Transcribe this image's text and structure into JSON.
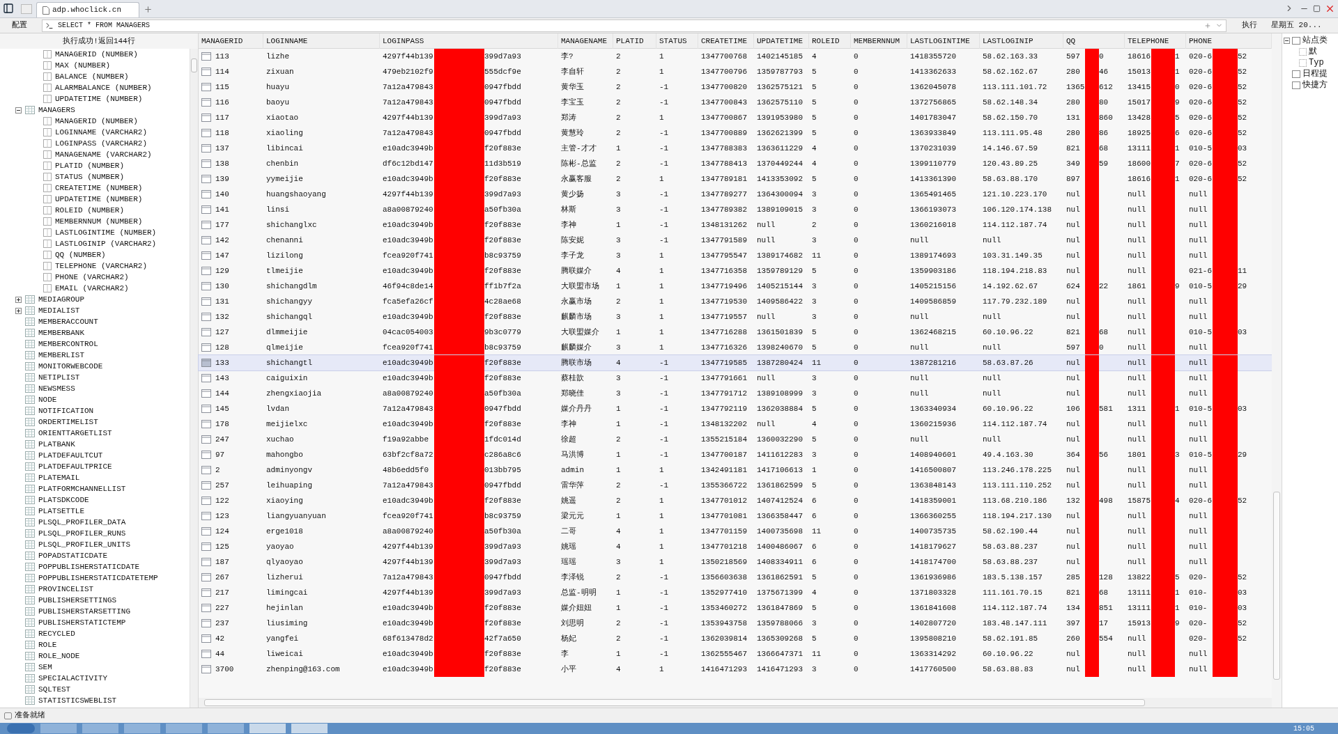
{
  "browser": {
    "tab_title": "adp.whoclick.cn",
    "date_text": "星期五 20...",
    "clock": "15:05"
  },
  "toolbar": {
    "config_button": "配置",
    "sql": "SELECT * FROM MANAGERS",
    "run_button": "执行"
  },
  "result_message": "执行成功!返回144行",
  "tree": [
    {
      "label": "MANAGERID (NUMBER)",
      "kind": "column"
    },
    {
      "label": "MAX (NUMBER)",
      "kind": "column"
    },
    {
      "label": "BALANCE (NUMBER)",
      "kind": "column"
    },
    {
      "label": "ALARMBALANCE (NUMBER)",
      "kind": "column"
    },
    {
      "label": "UPDATETIME (NUMBER)",
      "kind": "column"
    },
    {
      "label": "MANAGERS",
      "kind": "table",
      "expanded": true,
      "children": [
        {
          "label": "MANAGERID (NUMBER)",
          "kind": "column"
        },
        {
          "label": "LOGINNAME (VARCHAR2)",
          "kind": "column"
        },
        {
          "label": "LOGINPASS (VARCHAR2)",
          "kind": "column"
        },
        {
          "label": "MANAGENAME (VARCHAR2)",
          "kind": "column"
        },
        {
          "label": "PLATID (NUMBER)",
          "kind": "column"
        },
        {
          "label": "STATUS (NUMBER)",
          "kind": "column"
        },
        {
          "label": "CREATETIME (NUMBER)",
          "kind": "column"
        },
        {
          "label": "UPDATETIME (NUMBER)",
          "kind": "column"
        },
        {
          "label": "ROLEID (NUMBER)",
          "kind": "column"
        },
        {
          "label": "MEMBERNNUM (NUMBER)",
          "kind": "column"
        },
        {
          "label": "LASTLOGINTIME (NUMBER)",
          "kind": "column"
        },
        {
          "label": "LASTLOGINIP (VARCHAR2)",
          "kind": "column"
        },
        {
          "label": "QQ (NUMBER)",
          "kind": "column"
        },
        {
          "label": "TELEPHONE (VARCHAR2)",
          "kind": "column"
        },
        {
          "label": "PHONE (VARCHAR2)",
          "kind": "column"
        },
        {
          "label": "EMAIL (VARCHAR2)",
          "kind": "column"
        }
      ]
    },
    {
      "label": "MEDIAGROUP",
      "kind": "table",
      "expanded": false
    },
    {
      "label": "MEDIALIST",
      "kind": "table",
      "expanded": false
    },
    {
      "label": "MEMBERACCOUNT",
      "kind": "table"
    },
    {
      "label": "MEMBERBANK",
      "kind": "table"
    },
    {
      "label": "MEMBERCONTROL",
      "kind": "table"
    },
    {
      "label": "MEMBERLIST",
      "kind": "table"
    },
    {
      "label": "MONITORWEBCODE",
      "kind": "table"
    },
    {
      "label": "NETIPLIST",
      "kind": "table"
    },
    {
      "label": "NEWSMESS",
      "kind": "table"
    },
    {
      "label": "NODE",
      "kind": "table"
    },
    {
      "label": "NOTIFICATION",
      "kind": "table"
    },
    {
      "label": "ORDERTIMELIST",
      "kind": "table"
    },
    {
      "label": "ORIENTTARGETLIST",
      "kind": "table"
    },
    {
      "label": "PLATBANK",
      "kind": "table"
    },
    {
      "label": "PLATDEFAULTCUT",
      "kind": "table"
    },
    {
      "label": "PLATDEFAULTPRICE",
      "kind": "table"
    },
    {
      "label": "PLATEMAIL",
      "kind": "table"
    },
    {
      "label": "PLATFORMCHANNELLIST",
      "kind": "table"
    },
    {
      "label": "PLATSDKCODE",
      "kind": "table"
    },
    {
      "label": "PLATSETTLE",
      "kind": "table"
    },
    {
      "label": "PLSQL_PROFILER_DATA",
      "kind": "table"
    },
    {
      "label": "PLSQL_PROFILER_RUNS",
      "kind": "table"
    },
    {
      "label": "PLSQL_PROFILER_UNITS",
      "kind": "table"
    },
    {
      "label": "POPADSTATICDATE",
      "kind": "table"
    },
    {
      "label": "POPPUBLISHERSTATICDATE",
      "kind": "table"
    },
    {
      "label": "POPPUBLISHERSTATICDATETEMP",
      "kind": "table"
    },
    {
      "label": "PROVINCELIST",
      "kind": "table"
    },
    {
      "label": "PUBLISHERSETTINGS",
      "kind": "table"
    },
    {
      "label": "PUBLISHERSTARSETTING",
      "kind": "table"
    },
    {
      "label": "PUBLISHERSTATICTEMP",
      "kind": "table"
    },
    {
      "label": "RECYCLED",
      "kind": "table"
    },
    {
      "label": "ROLE",
      "kind": "table"
    },
    {
      "label": "ROLE_NODE",
      "kind": "table"
    },
    {
      "label": "SEM",
      "kind": "table"
    },
    {
      "label": "SPECIALACTIVITY",
      "kind": "table"
    },
    {
      "label": "SQLTEST",
      "kind": "table"
    },
    {
      "label": "STATISTICSWEBLIST",
      "kind": "table"
    }
  ],
  "table": {
    "columns": [
      {
        "label": "MANAGERID",
        "kind": "id"
      },
      {
        "label": "LOGINNAME",
        "kind": "text"
      },
      {
        "label": "LOGINPASS",
        "kind": "redacted"
      },
      {
        "label": "MANAGENAME",
        "kind": "text"
      },
      {
        "label": "PLATID",
        "kind": "text"
      },
      {
        "label": "STATUS",
        "kind": "text"
      },
      {
        "label": "CREATETIME",
        "kind": "text"
      },
      {
        "label": "UPDATETIME",
        "kind": "text"
      },
      {
        "label": "ROLEID",
        "kind": "text"
      },
      {
        "label": "MEMBERNNUM",
        "kind": "text"
      },
      {
        "label": "LASTLOGINTIME",
        "kind": "text"
      },
      {
        "label": "LASTLOGINIP",
        "kind": "text"
      },
      {
        "label": "QQ",
        "kind": "redacted"
      },
      {
        "label": "TELEPHONE",
        "kind": "redacted"
      },
      {
        "label": "PHONE",
        "kind": "redacted"
      }
    ],
    "rows": [
      {
        "selected": false,
        "cells": [
          "113",
          "lizhe",
          {
            "start": "4297f44b139",
            "end": "399d7a93"
          },
          "李?",
          "2",
          "1",
          "1347700768",
          "1402145185",
          "4",
          "0",
          "1418355720",
          "58.62.163.33",
          {
            "start": "597",
            "end": "0"
          },
          {
            "start": "18616",
            "end": "1"
          },
          {
            "start": "020-6",
            "end": "52"
          }
        ]
      },
      {
        "selected": false,
        "cells": [
          "114",
          "zixuan",
          {
            "start": "479eb2102f9",
            "end": "555dcf9e"
          },
          "李自轩",
          "2",
          "1",
          "1347700796",
          "1359787793",
          "5",
          "0",
          "1413362633",
          "58.62.162.67",
          {
            "start": "280",
            "end": "46"
          },
          {
            "start": "15013",
            "end": "1"
          },
          {
            "start": "020-6",
            "end": "52"
          }
        ]
      },
      {
        "selected": false,
        "cells": [
          "115",
          "huayu",
          {
            "start": "7a12a479843",
            "end": "0947fbdd"
          },
          "黄华玉",
          "2",
          "-1",
          "1347700820",
          "1362575121",
          "5",
          "0",
          "1362045078",
          "113.111.101.72",
          {
            "start": "1365",
            "end": "612"
          },
          {
            "start": "13415",
            "end": "0"
          },
          {
            "start": "020-6",
            "end": "52"
          }
        ]
      },
      {
        "selected": false,
        "cells": [
          "116",
          "baoyu",
          {
            "start": "7a12a479843",
            "end": "0947fbdd"
          },
          "李宝玉",
          "2",
          "-1",
          "1347700843",
          "1362575110",
          "5",
          "0",
          "1372756865",
          "58.62.148.34",
          {
            "start": "280",
            "end": "80"
          },
          {
            "start": "15017",
            "end": "9"
          },
          {
            "start": "020-6",
            "end": "52"
          }
        ]
      },
      {
        "selected": false,
        "cells": [
          "117",
          "xiaotao",
          {
            "start": "4297f44b139",
            "end": "399d7a93"
          },
          "郑涛",
          "2",
          "1",
          "1347700867",
          "1391953980",
          "5",
          "0",
          "1401783047",
          "58.62.150.70",
          {
            "start": "131",
            "end": "860"
          },
          {
            "start": "13428",
            "end": "5"
          },
          {
            "start": "020-6",
            "end": "52"
          }
        ]
      },
      {
        "selected": false,
        "cells": [
          "118",
          "xiaoling",
          {
            "start": "7a12a479843",
            "end": "0947fbdd"
          },
          "黄慧玲",
          "2",
          "-1",
          "1347700889",
          "1362621399",
          "5",
          "0",
          "1363933849",
          "113.111.95.48",
          {
            "start": "280",
            "end": "86"
          },
          {
            "start": "18925",
            "end": "6"
          },
          {
            "start": "020-6",
            "end": "52"
          }
        ]
      },
      {
        "selected": false,
        "cells": [
          "137",
          "libincai",
          {
            "start": "e10adc3949b",
            "end": "f20f883e"
          },
          "主管-才才",
          "1",
          "-1",
          "1347788383",
          "1363611229",
          "4",
          "0",
          "1370231039",
          "14.146.67.59",
          {
            "start": "821",
            "end": "68"
          },
          {
            "start": "13111",
            "end": "1"
          },
          {
            "start": "010-5",
            "end": "03"
          }
        ]
      },
      {
        "selected": false,
        "cells": [
          "138",
          "chenbin",
          {
            "start": "df6c12bd147",
            "end": "11d3b519"
          },
          "陈彬-总监",
          "2",
          "-1",
          "1347788413",
          "1370449244",
          "4",
          "0",
          "1399110779",
          "120.43.89.25",
          {
            "start": "349",
            "end": "59"
          },
          {
            "start": "18600",
            "end": "7"
          },
          {
            "start": "020-6",
            "end": "52"
          }
        ]
      },
      {
        "selected": false,
        "cells": [
          "139",
          "yymeijie",
          {
            "start": "e10adc3949b",
            "end": "f20f883e"
          },
          "永赢客服",
          "2",
          "1",
          "1347789181",
          "1413353092",
          "5",
          "0",
          "1413361390",
          "58.63.88.170",
          {
            "start": "897"
          },
          {
            "start": "18616",
            "end": "1"
          },
          {
            "start": "020-6",
            "end": "52"
          }
        ]
      },
      {
        "selected": false,
        "cells": [
          "140",
          "huangshaoyang",
          {
            "start": "4297f44b139",
            "end": "399d7a93"
          },
          "黄少扬",
          "3",
          "-1",
          "1347789277",
          "1364300094",
          "3",
          "0",
          "1365491465",
          "121.10.223.170",
          {
            "start": "nul"
          },
          {
            "start": "null"
          },
          {
            "start": "null"
          }
        ]
      },
      {
        "selected": false,
        "cells": [
          "141",
          "linsi",
          {
            "start": "a8a00879240",
            "end": "a50fb30a"
          },
          "林斯",
          "3",
          "-1",
          "1347789382",
          "1389109015",
          "3",
          "0",
          "1366193073",
          "106.120.174.138",
          {
            "start": "nul"
          },
          {
            "start": "null"
          },
          {
            "start": "null"
          }
        ]
      },
      {
        "selected": false,
        "cells": [
          "177",
          "shichanglxc",
          {
            "start": "e10adc3949b",
            "end": "f20f883e"
          },
          "李神",
          "1",
          "-1",
          "1348131262",
          "null",
          "2",
          "0",
          "1360216018",
          "114.112.187.74",
          {
            "start": "nul"
          },
          {
            "start": "null"
          },
          {
            "start": "null"
          }
        ]
      },
      {
        "selected": false,
        "cells": [
          "142",
          "chenanni",
          {
            "start": "e10adc3949b",
            "end": "f20f883e"
          },
          "陈安妮",
          "3",
          "-1",
          "1347791589",
          "null",
          "3",
          "0",
          "null",
          "null",
          {
            "start": "nul"
          },
          {
            "start": "null"
          },
          {
            "start": "null"
          }
        ]
      },
      {
        "selected": false,
        "cells": [
          "147",
          "lizilong",
          {
            "start": "fcea920f741",
            "end": "b8c93759"
          },
          "李子龙",
          "3",
          "1",
          "1347795547",
          "1389174682",
          "11",
          "0",
          "1389174693",
          "103.31.149.35",
          {
            "start": "nul"
          },
          {
            "start": "null"
          },
          {
            "start": "null"
          }
        ]
      },
      {
        "selected": false,
        "cells": [
          "129",
          "tlmeijie",
          {
            "start": "e10adc3949b",
            "end": "f20f883e"
          },
          "腾联媒介",
          "4",
          "1",
          "1347716358",
          "1359789129",
          "5",
          "0",
          "1359903186",
          "118.194.218.83",
          {
            "start": "nul"
          },
          {
            "start": "null"
          },
          {
            "start": "021-6",
            "end": "11"
          }
        ]
      },
      {
        "selected": false,
        "cells": [
          "130",
          "shichangdlm",
          {
            "start": "46f94c8de14",
            "end": "ff1b7f2a"
          },
          "大联盟市场",
          "1",
          "1",
          "1347719496",
          "1405215144",
          "3",
          "0",
          "1405215156",
          "14.192.62.67",
          {
            "start": "624",
            "end": "22"
          },
          {
            "start": "1861",
            "end": "9"
          },
          {
            "start": "010-5",
            "end": "29"
          }
        ]
      },
      {
        "selected": false,
        "cells": [
          "131",
          "shichangyy",
          {
            "start": "fca5efa26cf",
            "end": "4c28ae68"
          },
          "永赢市场",
          "2",
          "1",
          "1347719530",
          "1409586422",
          "3",
          "0",
          "1409586859",
          "117.79.232.189",
          {
            "start": "nul"
          },
          {
            "start": "null"
          },
          {
            "start": "null"
          }
        ]
      },
      {
        "selected": false,
        "cells": [
          "132",
          "shichangql",
          {
            "start": "e10adc3949b",
            "end": "f20f883e"
          },
          "麒麟市场",
          "3",
          "1",
          "1347719557",
          "null",
          "3",
          "0",
          "null",
          "null",
          {
            "start": "nul"
          },
          {
            "start": "null"
          },
          {
            "start": "null"
          }
        ]
      },
      {
        "selected": false,
        "cells": [
          "127",
          "dlmmeijie",
          {
            "start": "04cac054003",
            "end": "9b3c0779"
          },
          "大联盟媒介",
          "1",
          "1",
          "1347716288",
          "1361501839",
          "5",
          "0",
          "1362468215",
          "60.10.96.22",
          {
            "start": "821",
            "end": "68"
          },
          {
            "start": "null"
          },
          {
            "start": "010-5",
            "end": "03"
          }
        ]
      },
      {
        "selected": false,
        "cells": [
          "128",
          "qlmeijie",
          {
            "start": "fcea920f741",
            "end": "b8c93759"
          },
          "麒麟媒介",
          "3",
          "1",
          "1347716326",
          "1398240670",
          "5",
          "0",
          "null",
          "null",
          {
            "start": "597",
            "end": "0"
          },
          {
            "start": "null"
          },
          {
            "start": "null"
          }
        ]
      },
      {
        "selected": true,
        "cells": [
          "133",
          "shichangtl",
          {
            "start": "e10adc3949b",
            "end": "f20f883e"
          },
          "腾联市场",
          "4",
          "-1",
          "1347719585",
          "1387280424",
          "11",
          "0",
          "1387281216",
          "58.63.87.26",
          {
            "start": "nul"
          },
          {
            "start": "null"
          },
          {
            "start": "null"
          }
        ]
      },
      {
        "selected": false,
        "cells": [
          "143",
          "caiguixin",
          {
            "start": "e10adc3949b",
            "end": "f20f883e"
          },
          "蔡桂歆",
          "3",
          "-1",
          "1347791661",
          "null",
          "3",
          "0",
          "null",
          "null",
          {
            "start": "nul"
          },
          {
            "start": "null"
          },
          {
            "start": "null"
          }
        ]
      },
      {
        "selected": false,
        "cells": [
          "144",
          "zhengxiaojia",
          {
            "start": "a8a00879240",
            "end": "a50fb30a"
          },
          "郑晓佳",
          "3",
          "-1",
          "1347791712",
          "1389108999",
          "3",
          "0",
          "null",
          "null",
          {
            "start": "nul"
          },
          {
            "start": "null"
          },
          {
            "start": "null"
          }
        ]
      },
      {
        "selected": false,
        "cells": [
          "145",
          "lvdan",
          {
            "start": "7a12a479843",
            "end": "0947fbdd"
          },
          "媒介丹丹",
          "1",
          "-1",
          "1347792119",
          "1362038884",
          "5",
          "0",
          "1363340934",
          "60.10.96.22",
          {
            "start": "106",
            "end": "581"
          },
          {
            "start": "1311",
            "end": "1"
          },
          {
            "start": "010-5",
            "end": "03"
          }
        ]
      },
      {
        "selected": false,
        "cells": [
          "178",
          "meijielxc",
          {
            "start": "e10adc3949b",
            "end": "f20f883e"
          },
          "李神",
          "1",
          "-1",
          "1348132202",
          "null",
          "4",
          "0",
          "1360215936",
          "114.112.187.74",
          {
            "start": "nul"
          },
          {
            "start": "null"
          },
          {
            "start": "null"
          }
        ]
      },
      {
        "selected": false,
        "cells": [
          "247",
          "xuchao",
          {
            "start": "f19a92abbe",
            "end": "1fdc014d"
          },
          "徐超",
          "2",
          "-1",
          "1355215184",
          "1360032290",
          "5",
          "0",
          "null",
          "null",
          {
            "start": "nul"
          },
          {
            "start": "null"
          },
          {
            "start": "null"
          }
        ]
      },
      {
        "selected": false,
        "cells": [
          "97",
          "mahongbo",
          {
            "start": "63bf2cf8a72",
            "end": "c286a8c6"
          },
          "马洪博",
          "1",
          "-1",
          "1347700187",
          "1411612283",
          "3",
          "0",
          "1408940601",
          "49.4.163.30",
          {
            "start": "364",
            "end": "56"
          },
          {
            "start": "1801",
            "end": "3"
          },
          {
            "start": "010-5",
            "end": "29"
          }
        ]
      },
      {
        "selected": false,
        "cells": [
          "2",
          "adminyongv",
          {
            "start": "48b6edd5f0",
            "end": "013bb795"
          },
          "admin",
          "1",
          "1",
          "1342491181",
          "1417106613",
          "1",
          "0",
          "1416500807",
          "113.246.178.225",
          {
            "start": "nul"
          },
          {
            "start": "null"
          },
          {
            "start": "null"
          }
        ]
      },
      {
        "selected": false,
        "cells": [
          "257",
          "leihuaping",
          {
            "start": "7a12a479843",
            "end": "0947fbdd"
          },
          "雷华萍",
          "2",
          "-1",
          "1355366722",
          "1361862599",
          "5",
          "0",
          "1363848143",
          "113.111.110.252",
          {
            "start": "nul"
          },
          {
            "start": "null"
          },
          {
            "start": "null"
          }
        ]
      },
      {
        "selected": false,
        "cells": [
          "122",
          "xiaoying",
          {
            "start": "e10adc3949b",
            "end": "f20f883e"
          },
          "姚遥",
          "2",
          "1",
          "1347701012",
          "1407412524",
          "6",
          "0",
          "1418359001",
          "113.68.210.186",
          {
            "start": "132",
            "end": "498"
          },
          {
            "start": "15875",
            "end": "4"
          },
          {
            "start": "020-6",
            "end": "52"
          }
        ]
      },
      {
        "selected": false,
        "cells": [
          "123",
          "liangyuanyuan",
          {
            "start": "fcea920f741",
            "end": "b8c93759"
          },
          "梁元元",
          "1",
          "1",
          "1347701081",
          "1366358447",
          "6",
          "0",
          "1366360255",
          "118.194.217.130",
          {
            "start": "nul"
          },
          {
            "start": "null"
          },
          {
            "start": "null"
          }
        ]
      },
      {
        "selected": false,
        "cells": [
          "124",
          "erge1018",
          {
            "start": "a8a00879240",
            "end": "a50fb30a"
          },
          "二哥",
          "4",
          "1",
          "1347701159",
          "1400735698",
          "11",
          "0",
          "1400735735",
          "58.62.190.44",
          {
            "start": "nul"
          },
          {
            "start": "null"
          },
          {
            "start": "null"
          }
        ]
      },
      {
        "selected": false,
        "cells": [
          "125",
          "yaoyao",
          {
            "start": "4297f44b139",
            "end": "399d7a93"
          },
          "姚瑶",
          "4",
          "1",
          "1347701218",
          "1400486067",
          "6",
          "0",
          "1418179627",
          "58.63.88.237",
          {
            "start": "nul"
          },
          {
            "start": "null"
          },
          {
            "start": "null"
          }
        ]
      },
      {
        "selected": false,
        "cells": [
          "187",
          "qlyaoyao",
          {
            "start": "4297f44b139",
            "end": "399d7a93"
          },
          "瑶瑶",
          "3",
          "1",
          "1350218569",
          "1408334911",
          "6",
          "0",
          "1418174700",
          "58.63.88.237",
          {
            "start": "nul"
          },
          {
            "start": "null"
          },
          {
            "start": "null"
          }
        ]
      },
      {
        "selected": false,
        "cells": [
          "267",
          "lizherui",
          {
            "start": "7a12a479843",
            "end": "0947fbdd"
          },
          "李泽锐",
          "2",
          "-1",
          "1356603638",
          "1361862591",
          "5",
          "0",
          "1361936986",
          "183.5.138.157",
          {
            "start": "285",
            "end": "128"
          },
          {
            "start": "13822",
            "end": "5"
          },
          {
            "start": "020-",
            "end": "52"
          }
        ]
      },
      {
        "selected": false,
        "cells": [
          "217",
          "limingcai",
          {
            "start": "4297f44b139",
            "end": "399d7a93"
          },
          "总监-明明",
          "1",
          "-1",
          "1352977410",
          "1375671399",
          "4",
          "0",
          "1371803328",
          "111.161.70.15",
          {
            "start": "821",
            "end": "68"
          },
          {
            "start": "13111",
            "end": "1"
          },
          {
            "start": "010-",
            "end": "03"
          }
        ]
      },
      {
        "selected": false,
        "cells": [
          "227",
          "hejinlan",
          {
            "start": "e10adc3949b",
            "end": "f20f883e"
          },
          "媒介妞妞",
          "1",
          "-1",
          "1353460272",
          "1361847869",
          "5",
          "0",
          "1361841608",
          "114.112.187.74",
          {
            "start": "134",
            "end": "851"
          },
          {
            "start": "13111",
            "end": "1"
          },
          {
            "start": "010-",
            "end": "03"
          }
        ]
      },
      {
        "selected": false,
        "cells": [
          "237",
          "liusiming",
          {
            "start": "e10adc3949b",
            "end": "f20f883e"
          },
          "刘思明",
          "2",
          "-1",
          "1353943758",
          "1359788066",
          "3",
          "0",
          "1402807720",
          "183.48.147.111",
          {
            "start": "397",
            "end": "17"
          },
          {
            "start": "15913",
            "end": "9"
          },
          {
            "start": "020-",
            "end": "52"
          }
        ]
      },
      {
        "selected": false,
        "cells": [
          "42",
          "yangfei",
          {
            "start": "68f613478d2",
            "end": "42f7a650"
          },
          "杨妃",
          "2",
          "-1",
          "1362039814",
          "1365309268",
          "5",
          "0",
          "1395808210",
          "58.62.191.85",
          {
            "start": "260",
            "end": "554"
          },
          {
            "start": "null"
          },
          {
            "start": "020-",
            "end": "52"
          }
        ]
      },
      {
        "selected": false,
        "cells": [
          "44",
          "liweicai",
          {
            "start": "e10adc3949b",
            "end": "f20f883e"
          },
          "李",
          "1",
          "-1",
          "1362555467",
          "1366647371",
          "11",
          "0",
          "1363314292",
          "60.10.96.22",
          {
            "start": "nul"
          },
          {
            "start": "null"
          },
          {
            "start": "null"
          }
        ]
      },
      {
        "selected": false,
        "cells": [
          "3700",
          "zhenping@163.com",
          {
            "start": "e10adc3949b",
            "end": "f20f883e"
          },
          "小平",
          "4",
          "1",
          "1416471293",
          "1416471293",
          "3",
          "0",
          "1417760500",
          "58.63.88.83",
          {
            "start": "nul"
          },
          {
            "start": "null"
          },
          {
            "start": "null"
          }
        ]
      }
    ]
  },
  "side_tree": [
    {
      "label": "站点类",
      "expanded": true,
      "children": [
        {
          "label": "默"
        },
        {
          "label": "Typ"
        }
      ]
    },
    {
      "label": "日程提"
    },
    {
      "label": "快捷方"
    }
  ],
  "status_bar": {
    "text": "准备就绪"
  }
}
